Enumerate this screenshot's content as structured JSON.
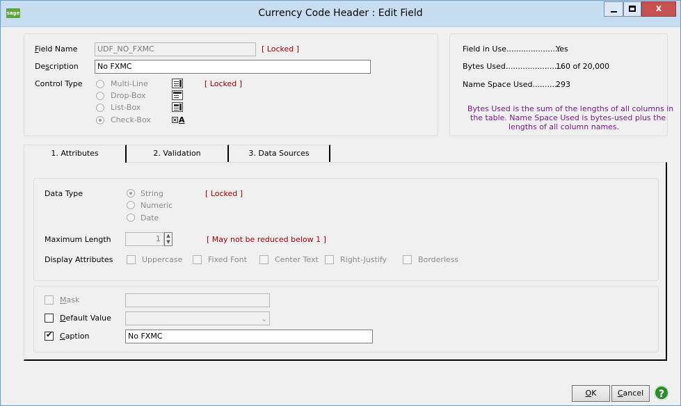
{
  "window": {
    "title": "Currency Code Header : Edit  Field",
    "app_icon": "sage",
    "controls": {
      "minimize": "minimize-icon",
      "maximize": "maximize-icon",
      "close": "x"
    }
  },
  "field": {
    "name_label": "Field Name",
    "name_value": "UDF_NO_FXMC",
    "name_locked": "[ Locked ]",
    "description_label": "Description",
    "description_value": "No FXMC",
    "control_type_label": "Control Type",
    "control_type_locked": "[ Locked ]",
    "control_types": [
      {
        "label": "Multi-Line",
        "selected": false,
        "icon": "multiline-icon"
      },
      {
        "label": "Drop-Box",
        "selected": false,
        "icon": "dropbox-icon"
      },
      {
        "label": "List-Box",
        "selected": false,
        "icon": "listbox-icon"
      },
      {
        "label": "Check-Box",
        "selected": true,
        "icon": "checkbox-control-icon"
      }
    ]
  },
  "usage": {
    "field_in_use_label": "Field in Use.......................",
    "field_in_use_value": "Yes",
    "bytes_used_label": "Bytes Used.......................",
    "bytes_used_value": "160 of 20,000",
    "name_space_label": "Name Space Used..........",
    "name_space_value": "293",
    "note_line1": "Bytes Used is the sum of the lengths of all columns in",
    "note_line2": "the table.  Name Space Used is bytes-used plus the",
    "note_line3": "lengths of all column names."
  },
  "tabs": [
    {
      "label": "1. Attributes",
      "active": true
    },
    {
      "label": "2. Validation",
      "active": false
    },
    {
      "label": "3. Data Sources",
      "active": false
    }
  ],
  "attributes": {
    "data_type_label": "Data Type",
    "data_type_locked": "[ Locked ]",
    "data_types": [
      {
        "label": "String",
        "selected": true
      },
      {
        "label": "Numeric",
        "selected": false
      },
      {
        "label": "Date",
        "selected": false
      }
    ],
    "max_length_label": "Maximum Length",
    "max_length_value": "1",
    "max_length_note": "[ May not be reduced below 1 ]",
    "display_attributes_label": "Display Attributes",
    "display_attributes": [
      {
        "label": "Uppercase",
        "checked": false
      },
      {
        "label": "Fixed Font",
        "checked": false
      },
      {
        "label": "Center Text",
        "checked": false
      },
      {
        "label": "Right-Justify",
        "checked": false
      },
      {
        "label": "Borderless",
        "checked": false
      }
    ]
  },
  "options": {
    "mask_label": "Mask",
    "mask_checked": false,
    "mask_value": "",
    "default_value_label": "Default Value",
    "default_value_checked": false,
    "default_value_value": "",
    "caption_label": "Caption",
    "caption_checked": true,
    "caption_value": "No FXMC"
  },
  "buttons": {
    "ok": "OK",
    "cancel": "Cancel",
    "help": "help-icon"
  }
}
